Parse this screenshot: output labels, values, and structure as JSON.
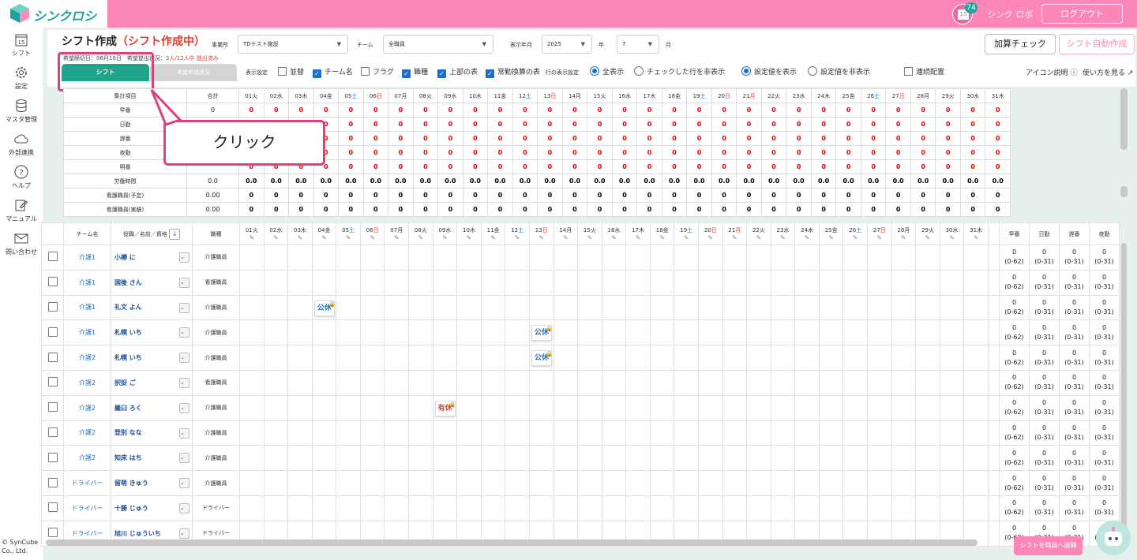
{
  "app": {
    "logo": "シンクロシフト",
    "badge": "74",
    "cal_day": "15",
    "user": "シンク ロボ",
    "logout": "ログアウト"
  },
  "sidebar": [
    {
      "icon": "calendar-icon",
      "label": "シフト",
      "day": "15"
    },
    {
      "icon": "gear-icon",
      "label": "設定"
    },
    {
      "icon": "database-icon",
      "label": "マスタ管理"
    },
    {
      "icon": "cloud-icon",
      "label": "外部連携"
    },
    {
      "icon": "help-icon",
      "label": "ヘルプ"
    },
    {
      "icon": "edit-icon",
      "label": "マニュアル"
    },
    {
      "icon": "mail-icon",
      "label": "問い合わせ"
    }
  ],
  "page": {
    "title": "シフト作成",
    "title_status": "（シフト作成中）"
  },
  "filters": {
    "office_label": "事業所",
    "office_value": "TDテスト施設",
    "team_label": "チーム",
    "team_value": "全職員",
    "ym_label": "表示年月",
    "year": "2025",
    "year_unit": "年",
    "month": "7",
    "month_unit": "月"
  },
  "buttons": {
    "check": "加算チェック",
    "auto": "シフト自動作成",
    "to_staff": "シフトを職員へ展開"
  },
  "info": {
    "deadline": "希望締切日：06月10日",
    "status_label": "希望提出状況：",
    "status_value": "3人/12人中 提出済み"
  },
  "tabs": {
    "shift": "シフト",
    "request": "希望申請状況"
  },
  "display": {
    "label": "表示設定",
    "opts": [
      {
        "label": "並替",
        "checked": false
      },
      {
        "label": "チーム名",
        "checked": true
      },
      {
        "label": "フラグ",
        "checked": false
      },
      {
        "label": "職種",
        "checked": true
      },
      {
        "label": "上部の表",
        "checked": true
      },
      {
        "label": "常勤換算の表",
        "checked": true
      }
    ],
    "row_label": "行の表示設定",
    "radio1": [
      {
        "label": "全表示",
        "on": true
      },
      {
        "label": "チェックした行を非表示",
        "on": false
      }
    ],
    "radio2": [
      {
        "label": "設定値を表示",
        "on": true
      },
      {
        "label": "設定値を非表示",
        "on": false
      }
    ],
    "consec": "連続配置",
    "icon_help": "アイコン説明",
    "howto": "使い方を見る"
  },
  "callout": "クリック",
  "days": [
    {
      "d": "01",
      "w": "火"
    },
    {
      "d": "02",
      "w": "水"
    },
    {
      "d": "03",
      "w": "木"
    },
    {
      "d": "04",
      "w": "金"
    },
    {
      "d": "05",
      "w": "土",
      "c": "sat"
    },
    {
      "d": "06",
      "w": "日",
      "c": "sun"
    },
    {
      "d": "07",
      "w": "月"
    },
    {
      "d": "08",
      "w": "火"
    },
    {
      "d": "09",
      "w": "水"
    },
    {
      "d": "10",
      "w": "木"
    },
    {
      "d": "11",
      "w": "金"
    },
    {
      "d": "12",
      "w": "土",
      "c": "sat"
    },
    {
      "d": "13",
      "w": "日",
      "c": "sun"
    },
    {
      "d": "14",
      "w": "月"
    },
    {
      "d": "15",
      "w": "火"
    },
    {
      "d": "16",
      "w": "水"
    },
    {
      "d": "17",
      "w": "木"
    },
    {
      "d": "18",
      "w": "金"
    },
    {
      "d": "19",
      "w": "土",
      "c": "sat"
    },
    {
      "d": "20",
      "w": "日",
      "c": "sun"
    },
    {
      "d": "21",
      "w": "月",
      "c": "sun"
    },
    {
      "d": "22",
      "w": "火"
    },
    {
      "d": "23",
      "w": "水"
    },
    {
      "d": "24",
      "w": "木"
    },
    {
      "d": "25",
      "w": "金"
    },
    {
      "d": "26",
      "w": "土",
      "c": "sat"
    },
    {
      "d": "27",
      "w": "日",
      "c": "sun"
    },
    {
      "d": "28",
      "w": "月"
    },
    {
      "d": "29",
      "w": "火"
    },
    {
      "d": "30",
      "w": "水"
    },
    {
      "d": "31",
      "w": "木"
    }
  ],
  "summary": {
    "head_label": "集計項目",
    "head_total": "合計",
    "rows": [
      {
        "label": "早番",
        "total": "0",
        "val": "0",
        "red": true
      },
      {
        "label": "日勤",
        "total": "",
        "val": "0",
        "red": true
      },
      {
        "label": "遅番",
        "total": "",
        "val": "0",
        "red": true
      },
      {
        "label": "夜勤",
        "total": "",
        "val": "0",
        "red": true
      },
      {
        "label": "明番",
        "total": "",
        "val": "0",
        "red": true
      },
      {
        "label": "労働時間",
        "total": "0.0",
        "val": "0.0",
        "red": false
      },
      {
        "label": "看護職員(予定)",
        "total": "0.00",
        "val": "0",
        "red": false
      },
      {
        "label": "看護職員(実績)",
        "total": "0.00",
        "val": "0",
        "red": false
      }
    ]
  },
  "staff_head": {
    "team": "チーム名",
    "name": "役職／名前／資格",
    "job": "職種",
    "sum_cols": [
      "早番",
      "日勤",
      "遅番",
      "夜勤"
    ]
  },
  "staff": [
    {
      "team": "介護1",
      "name": "小樽 に",
      "job": "介護職員"
    },
    {
      "team": "介護1",
      "name": "国後 さん",
      "job": "看護職員"
    },
    {
      "team": "介護1",
      "name": "礼文 よん",
      "job": "介護職員",
      "shift": {
        "day": 3,
        "label": "公休"
      }
    },
    {
      "team": "介護1",
      "name": "札幌 いち",
      "job": "介護職員",
      "shift": {
        "day": 12,
        "label": "公休"
      }
    },
    {
      "team": "介護2",
      "name": "札幌 いち",
      "job": "介護職員",
      "shift": {
        "day": 12,
        "label": "公休"
      }
    },
    {
      "team": "介護2",
      "name": "択捉 ご",
      "job": "看護職員"
    },
    {
      "team": "介護2",
      "name": "羅臼 ろく",
      "job": "介護職員",
      "shift": {
        "day": 8,
        "label": "有休",
        "yu": true
      }
    },
    {
      "team": "介護2",
      "name": "登別 なな",
      "job": "介護職員"
    },
    {
      "team": "介護2",
      "name": "知床 はち",
      "job": "介護職員"
    },
    {
      "team": "ドライバー",
      "name": "留萌 きゅう",
      "job": "介護職員"
    },
    {
      "team": "ドライバー",
      "name": "十勝 じゅう",
      "job": "ドライバー"
    },
    {
      "team": "ドライバー",
      "name": "旭川 じゅういち",
      "job": "ドライバー"
    }
  ],
  "staff_sum": {
    "val": "0",
    "r1": "(0-62)",
    "r2": "(0-31)"
  },
  "copyright": "© SynCube Co., Ltd.",
  "colors": {
    "header": "#fb86b7",
    "accent": "#1fa38b",
    "highlight": "#e0407a"
  }
}
